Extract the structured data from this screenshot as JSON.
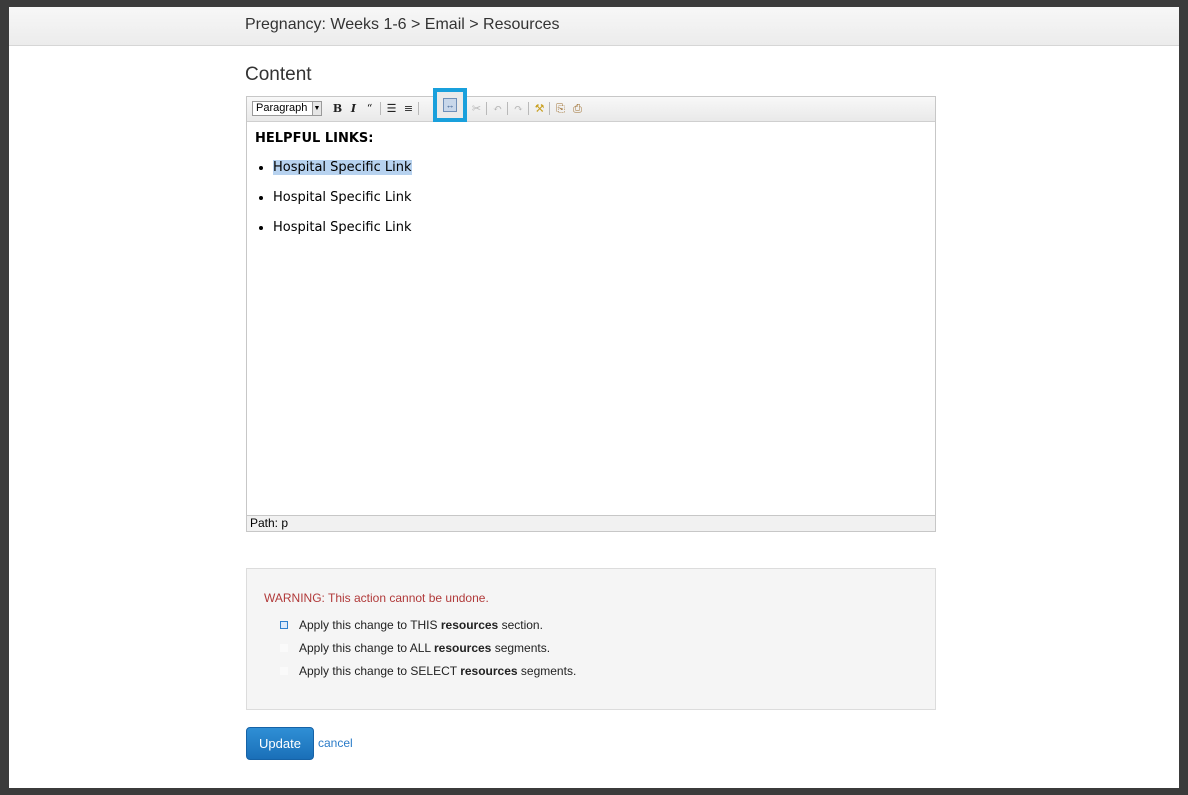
{
  "header": {
    "breadcrumb": "Pregnancy: Weeks 1-6 > Email > Resources"
  },
  "section": {
    "title": "Content"
  },
  "editor": {
    "format_select": "Paragraph",
    "toolbar": {
      "bold": "B",
      "italic": "I",
      "blockquote": "“",
      "bullet_list": "☰",
      "numbered_list": "≡",
      "link": "↔",
      "unlink": "✂",
      "undo": "↶",
      "redo": "↷",
      "cleanup": "⚒",
      "paste_text": "⎘",
      "paste_word": "⎙"
    },
    "heading": "HELPFUL LINKS:",
    "links": [
      "Hospital Specific Link",
      "Hospital Specific Link",
      "Hospital Specific Link"
    ],
    "selected_link_index": 0,
    "path": "Path: p"
  },
  "warning": {
    "message": "WARNING: This action cannot be undone.",
    "options": [
      {
        "pre": "Apply this change to THIS ",
        "bold": "resources",
        "post": " section.",
        "selected": true
      },
      {
        "pre": "Apply this change to ALL ",
        "bold": "resources",
        "post": " segments.",
        "selected": false
      },
      {
        "pre": "Apply this change to SELECT ",
        "bold": "resources",
        "post": " segments.",
        "selected": false
      }
    ]
  },
  "actions": {
    "update_label": "Update",
    "cancel_label": "cancel"
  },
  "colors": {
    "accent": "#19a0dc",
    "button": "#1a6fb8",
    "warning_text": "#b13a3a",
    "selection": "#b7d2ef"
  }
}
